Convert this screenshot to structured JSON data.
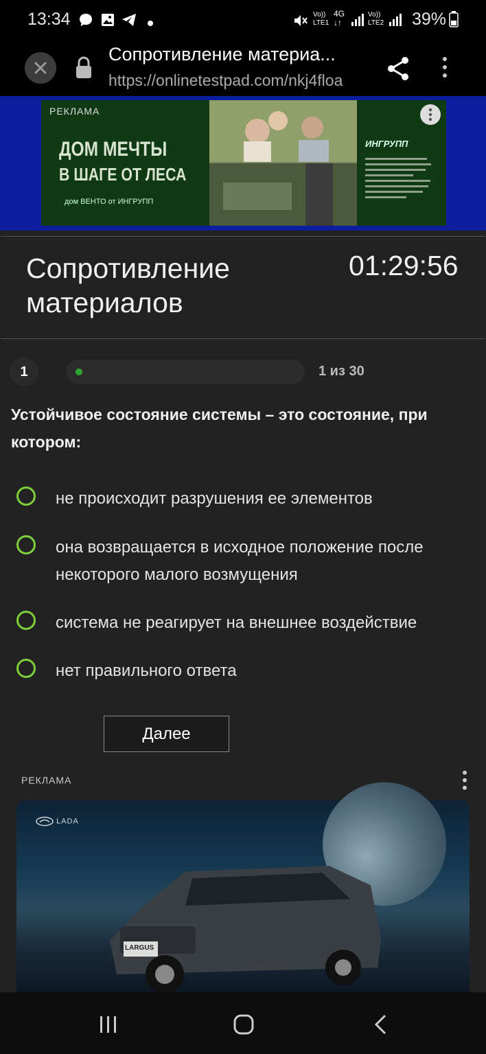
{
  "status_bar": {
    "time": "13:34",
    "battery": "39%",
    "sim1": "LTE1",
    "sim2": "LTE2",
    "network": "4G"
  },
  "browser": {
    "page_title": "Сопротивление материа...",
    "url": "https://onlinetestpad.com/nkj4floa"
  },
  "ad_top": {
    "label": "РЕКЛАМА",
    "headline_1": "ДОМ МЕЧТЫ",
    "headline_2": "В ШАГЕ ОТ ЛЕСА",
    "subline": "дом ВЕНТО от ИНГРУПП",
    "brand": "ИНГРУПП",
    "colors": {
      "border": "#0a1e9e",
      "bg": "#0f3a14"
    }
  },
  "test": {
    "title": "Сопротивление материалов",
    "timer": "01:29:56",
    "question_number": "1",
    "progress_text": "1 из 30",
    "progress_fraction": 0.033,
    "question": "Устойчивое состояние системы – это состояние, при котором:",
    "options": [
      {
        "label": "не происходит разрушения ее элементов"
      },
      {
        "label": "она возвращается в исходное положение после некоторого малого возмущения"
      },
      {
        "label": "система не реагирует на внешнее воздействие"
      },
      {
        "label": "нет правильного ответа"
      }
    ],
    "next_label": "Далее",
    "accent_color": "#7ed03a"
  },
  "ad_bottom": {
    "label": "РЕКЛАМА",
    "brand": "LADA",
    "model": "LARGUS"
  },
  "nav_bar": {
    "icons": [
      "recents-icon",
      "home-icon",
      "back-icon"
    ]
  }
}
